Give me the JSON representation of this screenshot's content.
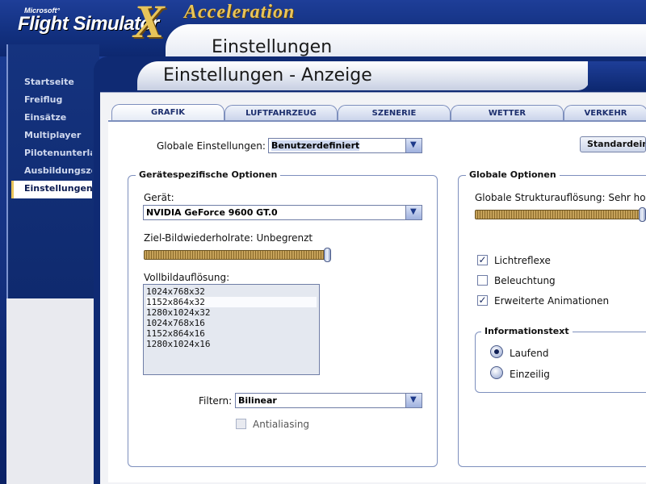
{
  "app": {
    "brand_small": "Microsoft°",
    "brand_name": "Flight Simulator",
    "brand_x": "X",
    "brand_sub": "Acceleration"
  },
  "header": {
    "section_title": "Einstellungen"
  },
  "page": {
    "title": "Einstellungen - Anzeige"
  },
  "sidebar": {
    "items": [
      {
        "label": "Startseite"
      },
      {
        "label": "Freiflug"
      },
      {
        "label": "Einsätze"
      },
      {
        "label": "Multiplayer"
      },
      {
        "label": "Pilotenunterlag"
      },
      {
        "label": "Ausbildungsze"
      },
      {
        "label": "Einstellungen"
      }
    ]
  },
  "tabs": [
    {
      "label": "GRAFIK"
    },
    {
      "label": "LUFTFAHRZEUG"
    },
    {
      "label": "SZENERIE"
    },
    {
      "label": "WETTER"
    },
    {
      "label": "VERKEHR"
    }
  ],
  "global_settings": {
    "label": "Globale Einstellungen:",
    "value": "Benutzerdefiniert",
    "default_button": "Standardeinst"
  },
  "device_options": {
    "title": "Gerätespezifische Optionen",
    "device_label": "Gerät:",
    "device_value": "NVIDIA GeForce 9600 GT.0",
    "refresh_label": "Ziel-Bildwiederholrate: Unbegrenzt",
    "refresh_level": 1.0,
    "resolution_label": "Vollbildauflösung:",
    "resolutions": [
      "1024x768x32",
      "1152x864x32",
      "1280x1024x32",
      "1024x768x16",
      "1152x864x16",
      "1280x1024x16"
    ],
    "selected_resolution_index": 1,
    "filter_label": "Filtern:",
    "filter_value": "Bilinear",
    "antialiasing_label": "Antialiasing"
  },
  "global_options": {
    "title": "Globale Optionen",
    "texture_label": "Globale Strukturauflösung: Sehr hoch",
    "texture_level": 1.0,
    "lens_flare_label": "Lichtreflexe",
    "lighting_label": "Beleuchtung",
    "animations_label": "Erweiterte Animationen",
    "check_mark": "✓",
    "info_text": {
      "title": "Informationstext",
      "scrolling_label": "Laufend",
      "single_line_label": "Einzeilig"
    }
  },
  "colors": {
    "brand_gold": "#e8c45a",
    "frame_blue": "#0f2a73"
  }
}
